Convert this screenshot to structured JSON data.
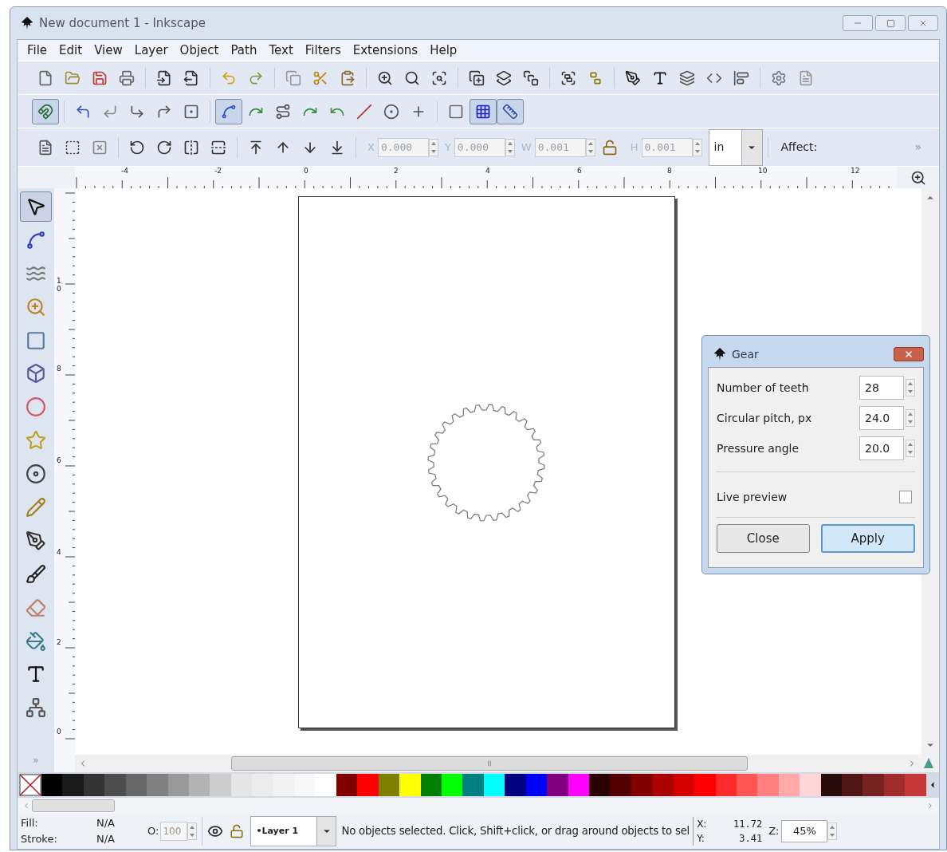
{
  "window": {
    "title": "New document 1 - Inkscape"
  },
  "menu": [
    "File",
    "Edit",
    "View",
    "Layer",
    "Object",
    "Path",
    "Text",
    "Filters",
    "Extensions",
    "Help"
  ],
  "snap_toolbar": {
    "buttons": [
      {
        "on": true
      },
      {
        "on": false
      },
      {
        "on": false
      },
      {
        "on": false
      },
      {
        "on": false
      },
      {
        "on": false
      },
      {
        "on": true
      },
      {
        "on": false
      },
      {
        "on": false
      },
      {
        "on": false
      },
      {
        "on": false
      },
      {
        "on": false
      },
      {
        "on": false
      },
      {
        "on": false
      },
      {
        "on": false
      },
      {
        "on": true
      },
      {
        "on": true
      }
    ]
  },
  "select_toolbar": {
    "fields": [
      {
        "label": "X",
        "value": "0.000",
        "disabled": true
      },
      {
        "label": "Y",
        "value": "0.000",
        "disabled": true
      },
      {
        "label": "W",
        "value": "0.001",
        "disabled": true
      },
      {
        "label": "H",
        "value": "0.001",
        "disabled": true
      }
    ],
    "unit": "in",
    "affect": "Affect:",
    "more": "»"
  },
  "horizontal_ruler": {
    "labels": [
      "-4",
      "-2",
      "0",
      "2",
      "4",
      "6",
      "8",
      "10",
      "12"
    ]
  },
  "vertical_ruler": {
    "labels": [
      "10",
      "8",
      "6",
      "4",
      "2",
      "0"
    ]
  },
  "toolbox": {
    "tools": [
      {
        "selected": true
      },
      {
        "selected": false
      },
      {
        "selected": false
      },
      {
        "selected": false
      },
      {
        "selected": false
      },
      {
        "selected": false
      },
      {
        "selected": false
      },
      {
        "selected": false
      },
      {
        "selected": false
      },
      {
        "selected": false
      },
      {
        "selected": false
      },
      {
        "selected": false
      },
      {
        "selected": false
      },
      {
        "selected": false
      },
      {
        "selected": false
      },
      {
        "selected": false
      }
    ],
    "more": "»"
  },
  "gear_dialog": {
    "title": "Gear",
    "fields": [
      {
        "label": "Number of teeth",
        "value": "28"
      },
      {
        "label": "Circular pitch, px",
        "value": "24.0"
      },
      {
        "label": "Pressure angle",
        "value": "20.0"
      }
    ],
    "live_preview": {
      "label": "Live preview",
      "checked": false
    },
    "buttons": [
      {
        "label": "Close",
        "default": false
      },
      {
        "label": "Apply",
        "default": true
      }
    ]
  },
  "palette": {
    "colors": [
      {
        "color": "#000000"
      },
      {
        "color": "#1a1a1a"
      },
      {
        "color": "#333333"
      },
      {
        "color": "#4d4d4d"
      },
      {
        "color": "#666666"
      },
      {
        "color": "#808080"
      },
      {
        "color": "#999999"
      },
      {
        "color": "#b3b3b3"
      },
      {
        "color": "#cccccc"
      },
      {
        "color": "#e6e6e6"
      },
      {
        "color": "#ececec"
      },
      {
        "color": "#f2f2f2"
      },
      {
        "color": "#f8f8f8"
      },
      {
        "color": "#ffffff"
      },
      {
        "color": "#800000"
      },
      {
        "color": "#ff0000"
      },
      {
        "color": "#808000"
      },
      {
        "color": "#ffff00"
      },
      {
        "color": "#008000"
      },
      {
        "color": "#00ff00"
      },
      {
        "color": "#008080"
      },
      {
        "color": "#00ffff"
      },
      {
        "color": "#000080"
      },
      {
        "color": "#0000ff"
      },
      {
        "color": "#800080"
      },
      {
        "color": "#ff00ff"
      },
      {
        "color": "#2b0000"
      },
      {
        "color": "#550000"
      },
      {
        "color": "#800000"
      },
      {
        "color": "#aa0000"
      },
      {
        "color": "#d40000"
      },
      {
        "color": "#ff0000"
      },
      {
        "color": "#ff2a2a"
      },
      {
        "color": "#ff5555"
      },
      {
        "color": "#ff8080"
      },
      {
        "color": "#ffaaaa"
      },
      {
        "color": "#ffd5d5"
      },
      {
        "color": "#280b0b"
      },
      {
        "color": "#501616"
      },
      {
        "color": "#782121"
      },
      {
        "color": "#a02c2c"
      },
      {
        "color": "#c83737"
      }
    ]
  },
  "status_bar": {
    "fill_label": "Fill:",
    "fill_value": "N/A",
    "stroke_label": "Stroke:",
    "stroke_value": "N/A",
    "opacity_label": "O:",
    "opacity_value": "100",
    "layer": "•Layer 1",
    "message": "No objects selected. Click, Shift+click, or drag around objects to sel",
    "x_label": "X:",
    "x_value": "11.72",
    "y_label": "Y:",
    "y_value": "3.41",
    "zoom_label": "Z:",
    "zoom_value": "45%"
  }
}
